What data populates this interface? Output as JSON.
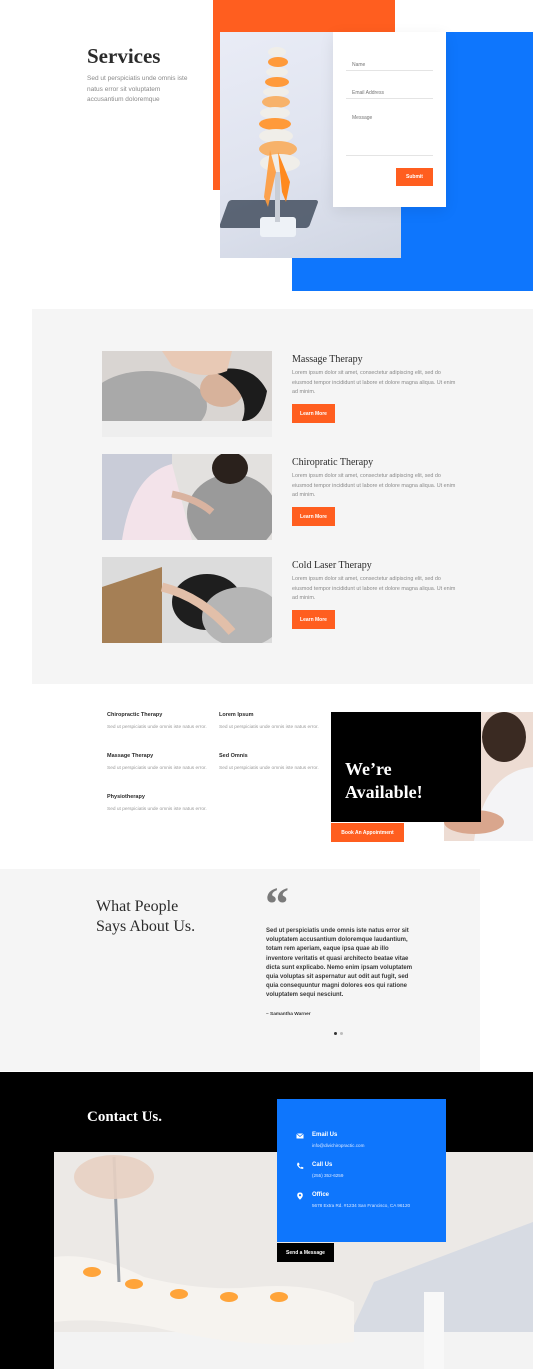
{
  "hero": {
    "title": "Services",
    "subtitle": "Sed ut perspiciatis unde omnis iste natus error sit voluptatem accusantium doloremque",
    "form": {
      "name_placeholder": "Name",
      "email_placeholder": "Email Address",
      "message_placeholder": "Message",
      "submit_label": "Submit"
    }
  },
  "services": {
    "items": [
      {
        "title": "Massage Therapy",
        "text": "Lorem ipsum dolor sit amet, consectetur adipiscing elit, sed do eiusmod tempor incididunt ut labore et dolore magna aliqua. Ut enim ad minim.",
        "button": "Learn More"
      },
      {
        "title": "Chiropratic Therapy",
        "text": "Lorem ipsum dolor sit amet, consectetur adipiscing elit, sed do eiusmod tempor incididunt ut labore et dolore magna aliqua. Ut enim ad minim.",
        "button": "Learn More"
      },
      {
        "title": "Cold Laser Therapy",
        "text": "Lorem ipsum dolor sit amet, consectetur adipiscing elit, sed do eiusmod tempor incididunt ut labore et dolore magna aliqua. Ut enim ad minim.",
        "button": "Learn More"
      }
    ]
  },
  "specialties": {
    "items": [
      {
        "title": "Chiropractic Therapy",
        "text": "Sed ut perspiciatis unde omnis iste natus error."
      },
      {
        "title": "Lorem Ipsum",
        "text": "Sed ut perspiciatis unde omnis iste natus error."
      },
      {
        "title": "Massage Therapy",
        "text": "Sed ut perspiciatis unde omnis iste natus error."
      },
      {
        "title": "Sed Omnis",
        "text": "Sed ut perspiciatis unde omnis iste natus error."
      },
      {
        "title": "Physiotherapy",
        "text": "Sed ut perspiciatis unde omnis iste natus error."
      }
    ],
    "available_title_line1": "We’re",
    "available_title_line2": "Available!",
    "available_button": "Book An Appointment"
  },
  "testimonials": {
    "title_line1": "What People",
    "title_line2": "Says About Us.",
    "quote_mark": "“",
    "quote": "Sed ut perspiciatis unde omnis iste natus error sit voluptatem accusantium doloremque laudantium, totam rem aperiam, eaque ipsa quae ab illo inventore veritatis et quasi architecto beatae vitae dicta sunt explicabo. Nemo enim ipsam voluptatem quia voluptas sit aspernatur aut odit aut fugit, sed quia consequuntur magni dolores eos qui ratione voluptatem sequi nesciunt.",
    "author": "– Samantha Warner"
  },
  "contact": {
    "title": "Contact Us.",
    "email_label": "Email Us",
    "email_value": "info@divichiropractic.com",
    "call_label": "Call Us",
    "call_value": "(255) 352-6259",
    "office_label": "Office",
    "office_value": "5678 Extra Rd. #1234 San Francisco, CA 96120",
    "send_button": "Send a Message"
  },
  "colors": {
    "accent_orange": "#ff5e1f",
    "accent_blue": "#0e76fd",
    "dark": "#000000",
    "light_bg": "#f5f5f5"
  }
}
